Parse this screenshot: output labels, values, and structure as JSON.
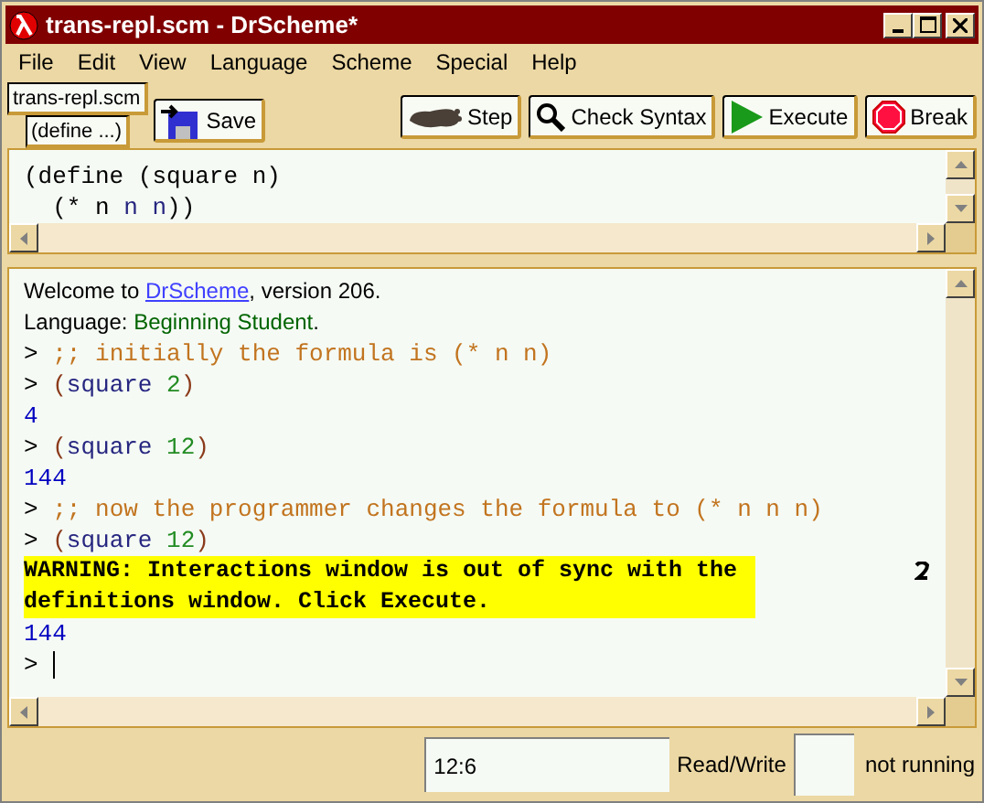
{
  "window": {
    "title": "trans-repl.scm - DrScheme*"
  },
  "menu": [
    "File",
    "Edit",
    "View",
    "Language",
    "Scheme",
    "Special",
    "Help"
  ],
  "toolbar": {
    "file_name": "trans-repl.scm",
    "definitions_menu": "(define ...)",
    "left_buttons": [
      {
        "label": "Save",
        "kind": "save"
      }
    ],
    "right_buttons": [
      {
        "label": "Step",
        "kind": "step"
      },
      {
        "label": "Check Syntax",
        "kind": "check"
      },
      {
        "label": "Execute",
        "kind": "execute"
      },
      {
        "label": "Break",
        "kind": "break"
      }
    ]
  },
  "definitions": {
    "lines": [
      {
        "indented": false,
        "segments": [
          {
            "text": "(define (square n)",
            "kind": "plain"
          }
        ]
      },
      {
        "indented": true,
        "segments": [
          {
            "text": "(* n ",
            "kind": "plain"
          },
          {
            "text": "n n",
            "kind": "bound"
          },
          {
            "text": "))",
            "kind": "plain"
          }
        ]
      }
    ]
  },
  "interactions": {
    "lines": [
      {
        "kind": "banner",
        "segments": [
          {
            "text": "Welcome to ",
            "kind": "plain"
          },
          {
            "text": "DrScheme",
            "kind": "link"
          },
          {
            "text": ", version 206.",
            "kind": "plain"
          }
        ]
      },
      {
        "kind": "banner",
        "segments": [
          {
            "text": "Language: ",
            "kind": "plain"
          },
          {
            "text": "Beginning Student",
            "kind": "language"
          },
          {
            "text": ".",
            "kind": "plain"
          }
        ]
      },
      {
        "kind": "code",
        "segments": [
          {
            "text": "> ",
            "kind": "prompt"
          },
          {
            "text": ";; initially the formula is (* n n)",
            "kind": "comment"
          }
        ]
      },
      {
        "kind": "code",
        "segments": [
          {
            "text": "> ",
            "kind": "prompt"
          },
          {
            "text": "(",
            "kind": "paren"
          },
          {
            "text": "square ",
            "kind": "symbol"
          },
          {
            "text": "2",
            "kind": "number"
          },
          {
            "text": ")",
            "kind": "paren"
          }
        ]
      },
      {
        "kind": "code",
        "segments": [
          {
            "text": "4",
            "kind": "result"
          }
        ]
      },
      {
        "kind": "code",
        "segments": [
          {
            "text": "> ",
            "kind": "prompt"
          },
          {
            "text": "(",
            "kind": "paren"
          },
          {
            "text": "square ",
            "kind": "symbol"
          },
          {
            "text": "12",
            "kind": "number"
          },
          {
            "text": ")",
            "kind": "paren"
          }
        ]
      },
      {
        "kind": "code",
        "segments": [
          {
            "text": "144",
            "kind": "result"
          }
        ]
      },
      {
        "kind": "code",
        "segments": [
          {
            "text": "> ",
            "kind": "prompt"
          },
          {
            "text": ";; now the programmer changes the formula to (* n n n)",
            "kind": "comment"
          }
        ]
      },
      {
        "kind": "code",
        "segments": [
          {
            "text": "> ",
            "kind": "prompt"
          },
          {
            "text": "(",
            "kind": "paren"
          },
          {
            "text": "square ",
            "kind": "symbol"
          },
          {
            "text": "12",
            "kind": "number"
          },
          {
            "text": ")",
            "kind": "paren"
          }
        ]
      },
      {
        "kind": "warning",
        "segments": [
          {
            "text": "WARNING: Interactions window is out of sync with the definitions window. Click Execute.",
            "kind": "warning"
          }
        ]
      },
      {
        "kind": "code",
        "segments": [
          {
            "text": "144",
            "kind": "result"
          }
        ]
      },
      {
        "kind": "input",
        "segments": [
          {
            "text": "> ",
            "kind": "prompt"
          }
        ]
      }
    ]
  },
  "status_bar": {
    "position": "12:6",
    "mode": "Read/Write",
    "state": "not running"
  }
}
